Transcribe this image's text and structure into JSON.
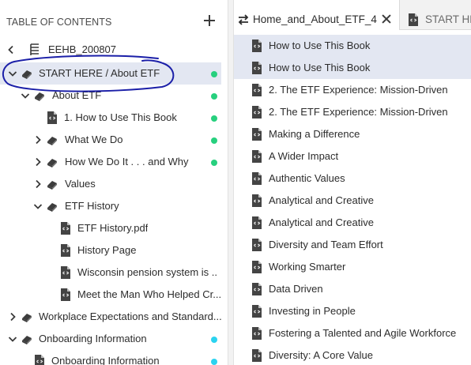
{
  "toc": {
    "title": "TABLE OF CONTENTS",
    "items": [
      {
        "label": "EEHB_200807"
      },
      {
        "label": "START HERE / About ETF"
      },
      {
        "label": "About ETF"
      },
      {
        "label": "1. How to Use This Book"
      },
      {
        "label": "What We Do"
      },
      {
        "label": "How We Do It . . . and Why"
      },
      {
        "label": "Values"
      },
      {
        "label": "ETF History"
      },
      {
        "label": "ETF History.pdf"
      },
      {
        "label": "History Page"
      },
      {
        "label": "Wisconsin pension system is ..."
      },
      {
        "label": "Meet the Man Who Helped Cr..."
      },
      {
        "label": "Workplace Expectations and Standard..."
      },
      {
        "label": "Onboarding Information"
      },
      {
        "label": "Onboarding Information"
      }
    ]
  },
  "tabs": [
    {
      "label": "Home_and_About_ETF_4"
    },
    {
      "label": "START HE"
    }
  ],
  "pages": [
    {
      "label": "How to Use This Book"
    },
    {
      "label": "How to Use This Book"
    },
    {
      "label": "2. The ETF Experience: Mission-Driven"
    },
    {
      "label": "2. The ETF Experience: Mission-Driven"
    },
    {
      "label": "Making a Difference"
    },
    {
      "label": "A Wider Impact"
    },
    {
      "label": "Authentic Values"
    },
    {
      "label": "Analytical and Creative"
    },
    {
      "label": "Analytical and Creative"
    },
    {
      "label": "Diversity and Team Effort"
    },
    {
      "label": "Working Smarter"
    },
    {
      "label": "Data Driven"
    },
    {
      "label": "Investing in People"
    },
    {
      "label": "Fostering a Talented and Agile Workforce"
    },
    {
      "label": "Diversity: A Core Value"
    }
  ],
  "colors": {
    "selection": "#e3e7f2",
    "status_green": "#27d07e",
    "status_cyan": "#2bd3f0",
    "annotation_ink": "#1b1fa8"
  },
  "icons": {
    "add": "plus-icon",
    "collapse": "chevron-left-icon",
    "expand": "chevron-right-icon",
    "expanded": "chevron-down-icon",
    "book": "book-icon",
    "section": "section-icon",
    "page": "page-icon",
    "tab_swap": "swap-arrows-icon",
    "close": "close-icon"
  }
}
